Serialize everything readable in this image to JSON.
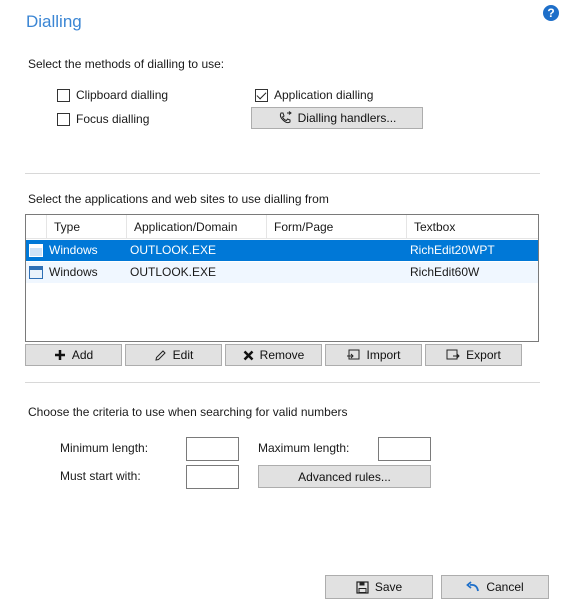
{
  "header": {
    "title": "Dialling",
    "help_icon": "?"
  },
  "methods": {
    "label": "Select the methods of dialling to use:",
    "clipboard": {
      "label": "Clipboard dialling",
      "checked": false
    },
    "focus": {
      "label": "Focus dialling",
      "checked": false
    },
    "application": {
      "label": "Application dialling",
      "checked": true
    },
    "handlers_button": "Dialling handlers..."
  },
  "apps": {
    "label": "Select the applications and web sites to use dialling from",
    "columns": [
      "Type",
      "Application/Domain",
      "Form/Page",
      "Textbox"
    ],
    "rows": [
      {
        "type": "Windows",
        "app": "OUTLOOK.EXE",
        "form": "",
        "textbox": "RichEdit20WPT",
        "selected": true
      },
      {
        "type": "Windows",
        "app": "OUTLOOK.EXE",
        "form": "",
        "textbox": "RichEdit60W",
        "selected": false
      }
    ],
    "buttons": {
      "add": "Add",
      "edit": "Edit",
      "remove": "Remove",
      "import": "Import",
      "export": "Export"
    }
  },
  "criteria": {
    "label": "Choose the criteria to use when searching for valid numbers",
    "min_label": "Minimum length:",
    "min_value": "",
    "max_label": "Maximum length:",
    "max_value": "",
    "start_label": "Must start with:",
    "start_value": "",
    "advanced_button": "Advanced rules..."
  },
  "footer": {
    "save": "Save",
    "cancel": "Cancel"
  },
  "colors": {
    "accent": "#3b86d4",
    "selection": "#0078d7",
    "help": "#1e6fc9"
  }
}
